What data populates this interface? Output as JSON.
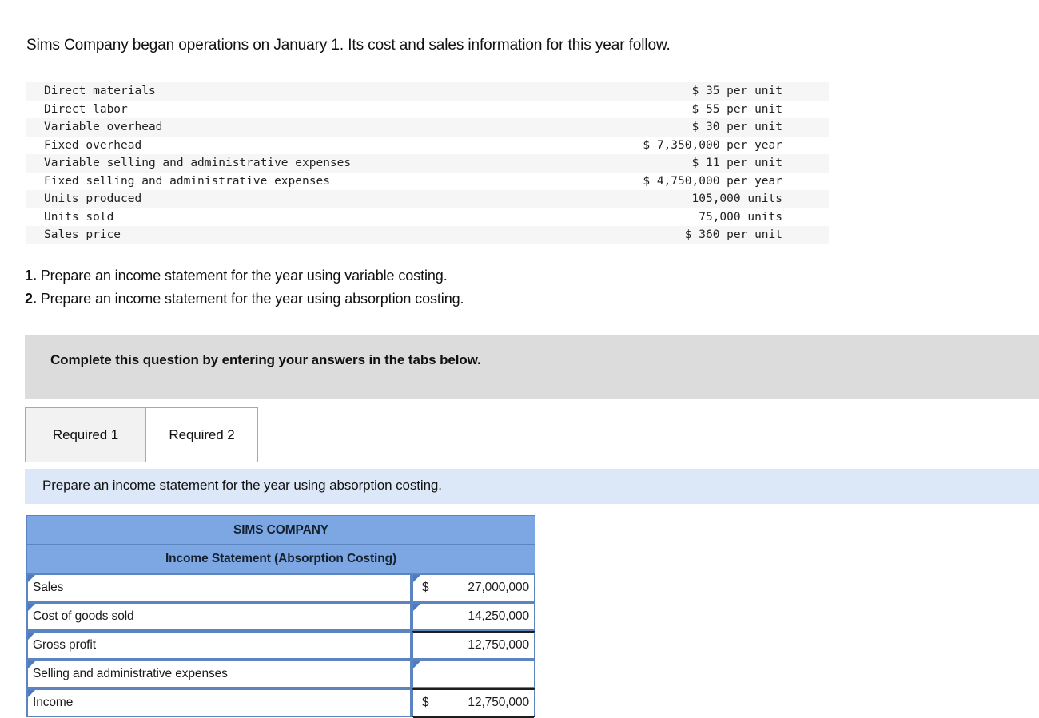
{
  "intro": "Sims Company began operations on January 1. Its cost and sales information for this year follow.",
  "facts": {
    "rows": [
      {
        "label": "Direct materials",
        "value": "$ 35 per unit"
      },
      {
        "label": "Direct labor",
        "value": "$ 55 per unit"
      },
      {
        "label": "Variable overhead",
        "value": "$ 30 per unit"
      },
      {
        "label": "Fixed overhead",
        "value": "$ 7,350,000 per year"
      },
      {
        "label": "Variable selling and administrative expenses",
        "value": "$ 11 per unit"
      },
      {
        "label": "Fixed selling and administrative expenses",
        "value": "$ 4,750,000 per year"
      },
      {
        "label": "Units produced",
        "value": "105,000 units"
      },
      {
        "label": "Units sold",
        "value": "75,000 units"
      },
      {
        "label": "Sales price",
        "value": "$ 360 per unit"
      }
    ]
  },
  "requirements": [
    {
      "number": "1.",
      "text": "Prepare an income statement for the year using variable costing."
    },
    {
      "number": "2.",
      "text": "Prepare an income statement for the year using absorption costing."
    }
  ],
  "banner": {
    "text": "Complete this question by entering your answers in the tabs below.",
    "background": "#dcdcdc"
  },
  "tabs": [
    {
      "label": "Required 1",
      "active": false
    },
    {
      "label": "Required 2",
      "active": true
    }
  ],
  "prompt": {
    "text": "Prepare an income statement for the year using absorption costing.",
    "background": "#dce8f7"
  },
  "statement": {
    "header_background": "#7da7e3",
    "company": "SIMS COMPANY",
    "title": "Income Statement (Absorption Costing)",
    "rows": [
      {
        "label": "Sales",
        "dollar": "$",
        "value": "27,000,000"
      },
      {
        "label": "Cost of goods sold",
        "dollar": "",
        "value": "14,250,000"
      },
      {
        "label": "Gross profit",
        "dollar": "",
        "value": "12,750,000"
      },
      {
        "label": "Selling and administrative expenses",
        "dollar": "",
        "value": ""
      },
      {
        "label": "Income",
        "dollar": "$",
        "value": "12,750,000"
      }
    ]
  }
}
